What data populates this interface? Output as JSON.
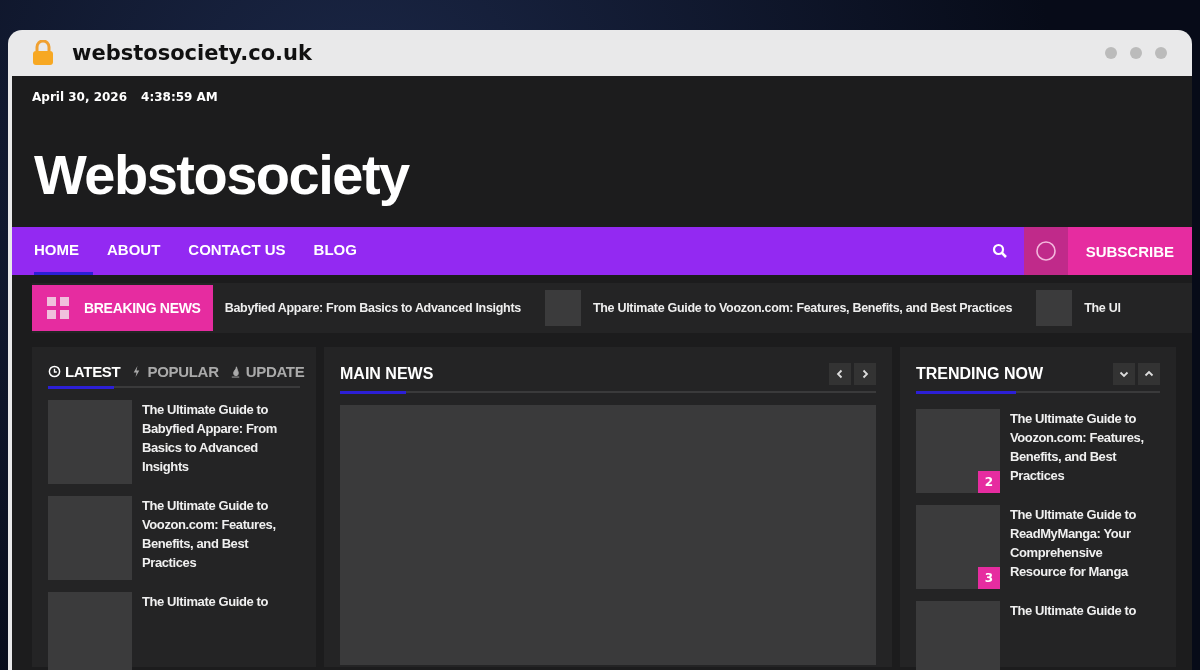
{
  "browser": {
    "url": "webstosociety.co.uk"
  },
  "top_bar": {
    "date": "April 30, 2026",
    "time": "4:38:59 AM"
  },
  "site_title": "Webstosociety",
  "nav": [
    {
      "label": "HOME",
      "selected": true
    },
    {
      "label": "ABOUT",
      "selected": false
    },
    {
      "label": "CONTACT US",
      "selected": false
    },
    {
      "label": "BLOG",
      "selected": false
    }
  ],
  "subscribe": "SUBSCRIBE",
  "ticker": {
    "label": "BREAKING NEWS",
    "items": [
      {
        "title": "Babyfied Appare: From Basics to Advanced Insights",
        "thumb": false
      },
      {
        "title": "The Ultimate Guide to Voozon.com: Features, Benefits, and Best Practices",
        "thumb": true
      },
      {
        "title": "The Ul",
        "thumb": true
      }
    ]
  },
  "tabs": [
    {
      "label": "LATEST",
      "selected": true
    },
    {
      "label": "POPULAR",
      "selected": false
    },
    {
      "label": "UPDATE",
      "selected": false
    }
  ],
  "latest": [
    {
      "title": "The Ultimate Guide to Babyfied Appare: From Basics to Advanced Insights"
    },
    {
      "title": "The Ultimate Guide to Voozon.com: Features, Benefits, and Best Practices"
    },
    {
      "title": "The Ultimate Guide to"
    }
  ],
  "main_news": {
    "title": "MAIN NEWS"
  },
  "trending": {
    "title": "TRENDING NOW",
    "items": [
      {
        "rank": "2",
        "title": "The Ultimate Guide to Voozon.com: Features, Benefits, and Best Practices"
      },
      {
        "rank": "3",
        "title": "The Ultimate Guide to ReadMyManga: Your Comprehensive Resource for Manga"
      },
      {
        "title": "The Ultimate Guide to"
      }
    ]
  }
}
